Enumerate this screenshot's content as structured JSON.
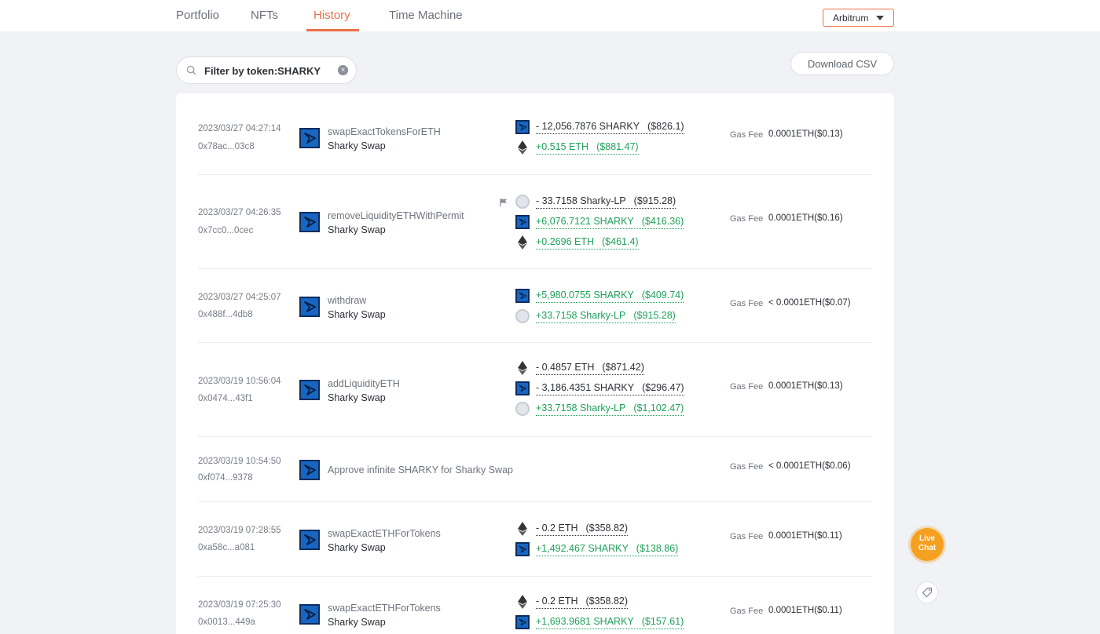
{
  "nav": {
    "tabs": [
      "Portfolio",
      "NFTs",
      "History",
      "Time Machine"
    ],
    "active": "History",
    "chain": "Arbitrum"
  },
  "filter": {
    "text": "Filter by token:SHARKY"
  },
  "toolbar": {
    "download_label": "Download CSV"
  },
  "colors": {
    "accent": "#ee6f48",
    "positive": "#1fa15a",
    "sharky_blue": "#1766c2"
  },
  "gas_label": "Gas Fee",
  "transactions": [
    {
      "time": "2023/03/27 04:27:14",
      "hash": "0x78ac...03c8",
      "method": "swapExactTokensForETH",
      "app": "Sharky Swap",
      "tokens": [
        {
          "icon": "sharky-icon",
          "dir": "out",
          "amount": "- 12,056.7876 SHARKY",
          "usd": "($826.1)"
        },
        {
          "icon": "eth-icon",
          "dir": "in",
          "amount": "+0.515 ETH",
          "usd": "($881.47)"
        }
      ],
      "gas": "0.0001ETH($0.13)"
    },
    {
      "time": "2023/03/27 04:26:35",
      "hash": "0x7cc0...0cec",
      "method": "removeLiquidityETHWithPermit",
      "app": "Sharky Swap",
      "flagged": true,
      "tokens": [
        {
          "icon": "lp-icon",
          "dir": "out",
          "amount": "- 33.7158 Sharky-LP",
          "usd": "($915.28)"
        },
        {
          "icon": "sharky-icon",
          "dir": "in",
          "amount": "+6,076.7121 SHARKY",
          "usd": "($416.36)"
        },
        {
          "icon": "eth-icon",
          "dir": "in",
          "amount": "+0.2696 ETH",
          "usd": "($461.4)"
        }
      ],
      "gas": "0.0001ETH($0.16)"
    },
    {
      "time": "2023/03/27 04:25:07",
      "hash": "0x488f...4db8",
      "method": "withdraw",
      "app": "Sharky Swap",
      "tokens": [
        {
          "icon": "sharky-icon",
          "dir": "in",
          "amount": "+5,980.0755 SHARKY",
          "usd": "($409.74)"
        },
        {
          "icon": "lp-icon",
          "dir": "in",
          "amount": "+33.7158 Sharky-LP",
          "usd": "($915.28)"
        }
      ],
      "gas": "< 0.0001ETH($0.07)"
    },
    {
      "time": "2023/03/19 10:56:04",
      "hash": "0x0474...43f1",
      "method": "addLiquidityETH",
      "app": "Sharky Swap",
      "tokens": [
        {
          "icon": "eth-icon",
          "dir": "out",
          "amount": "- 0.4857 ETH",
          "usd": "($871.42)"
        },
        {
          "icon": "sharky-icon",
          "dir": "out",
          "amount": "- 3,186.4351 SHARKY",
          "usd": "($296.47)"
        },
        {
          "icon": "lp-icon",
          "dir": "in",
          "amount": "+33.7158 Sharky-LP",
          "usd": "($1,102.47)"
        }
      ],
      "gas": "0.0001ETH($0.13)"
    },
    {
      "time": "2023/03/19 10:54:50",
      "hash": "0xf074...9378",
      "method": "Approve infinite SHARKY for Sharky Swap",
      "app": "",
      "tokens": [],
      "gas": "< 0.0001ETH($0.06)"
    },
    {
      "time": "2023/03/19 07:28:55",
      "hash": "0xa58c...a081",
      "method": "swapExactETHForTokens",
      "app": "Sharky Swap",
      "tokens": [
        {
          "icon": "eth-icon",
          "dir": "out",
          "amount": "- 0.2 ETH",
          "usd": "($358.82)"
        },
        {
          "icon": "sharky-icon",
          "dir": "in",
          "amount": "+1,492.467 SHARKY",
          "usd": "($138.86)"
        }
      ],
      "gas": "0.0001ETH($0.11)"
    },
    {
      "time": "2023/03/19 07:25:30",
      "hash": "0x0013...449a",
      "method": "swapExactETHForTokens",
      "app": "Sharky Swap",
      "tokens": [
        {
          "icon": "eth-icon",
          "dir": "out",
          "amount": "- 0.2 ETH",
          "usd": "($358.82)"
        },
        {
          "icon": "sharky-icon",
          "dir": "in",
          "amount": "+1,693.9681 SHARKY",
          "usd": "($157.61)"
        }
      ],
      "gas": "0.0001ETH($0.11)"
    }
  ],
  "support": {
    "live_chat": "Live Chat"
  }
}
